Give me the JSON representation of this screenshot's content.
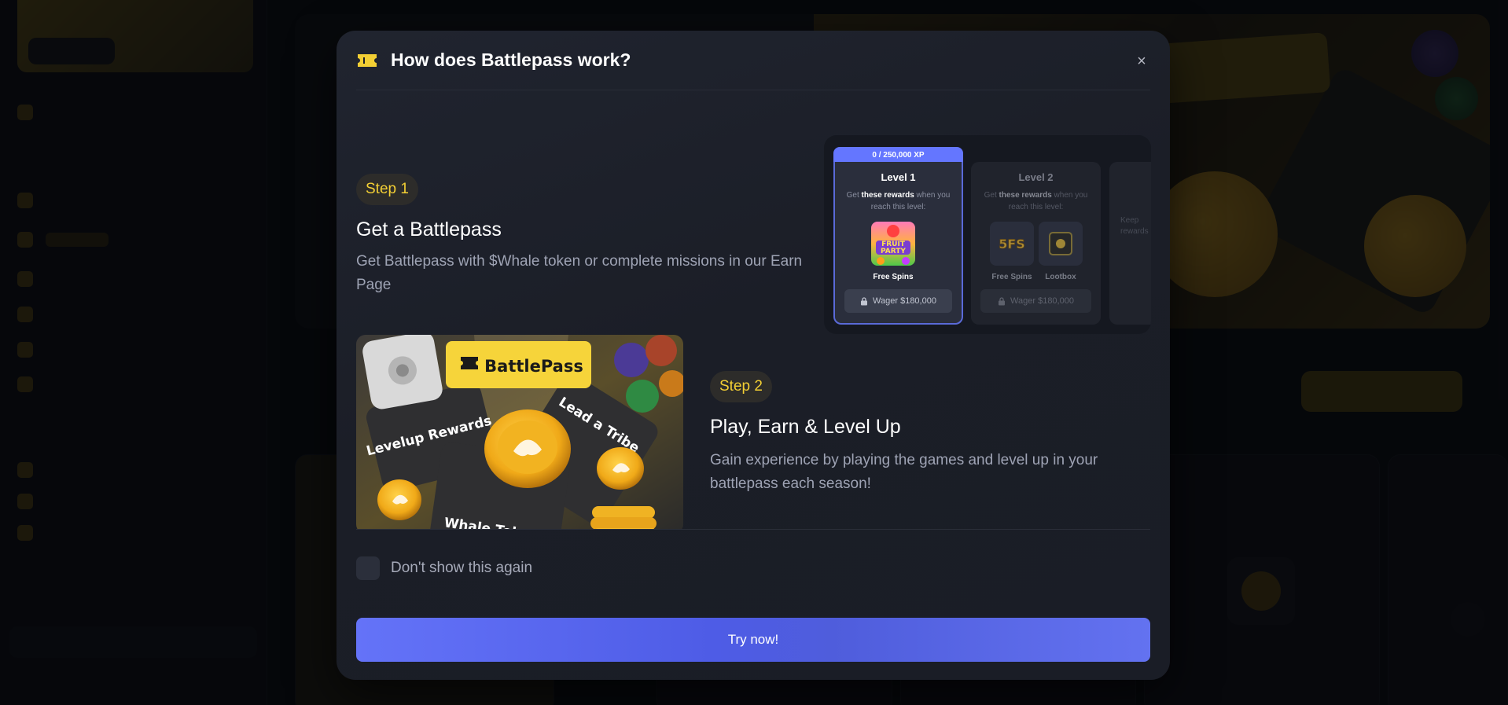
{
  "modal": {
    "title": "How does Battlepass work?",
    "close_label": "×",
    "step1": {
      "pill": "Step 1",
      "title": "Get a Battlepass",
      "description": "Get Battlepass with $Whale token or complete missions in our Earn Page"
    },
    "step2": {
      "pill": "Step 2",
      "title": "Play, Earn & Level Up",
      "description": "Gain experience by playing the games and level up in your battlepass each season!"
    },
    "level_preview": {
      "xp_label": "0 / 250,000 XP",
      "levels": [
        {
          "name": "Level 1",
          "text_prefix": "Get ",
          "text_bold": "these rewards",
          "text_suffix": " when you reach this level:",
          "rewards": [
            "Free Spins"
          ],
          "wager": "Wager $180,000"
        },
        {
          "name": "Level 2",
          "text_prefix": "Get ",
          "text_bold": "these rewards",
          "text_suffix": " when you reach this level:",
          "rewards": [
            "Free Spins",
            "Lootbox"
          ],
          "wager": "Wager $180,000"
        }
      ],
      "peek_text": "Keep rewards"
    },
    "promo_art": {
      "brand": "BattlePass",
      "card_left": "Levelup Rewards",
      "card_right": "Lead a Tribe",
      "card_bottom": "Whale Tokens",
      "tile_fs_text": "5FS",
      "tile_fruit_top": "FRUIT",
      "tile_fruit_bottom": "PARTY"
    },
    "footer": {
      "checkbox_label": "Don't show this again",
      "cta_label": "Try now!"
    }
  },
  "colors": {
    "accent_yellow": "#f3cf34",
    "cta_blue": "#5665ec",
    "modal_bg": "#1c1f28"
  }
}
